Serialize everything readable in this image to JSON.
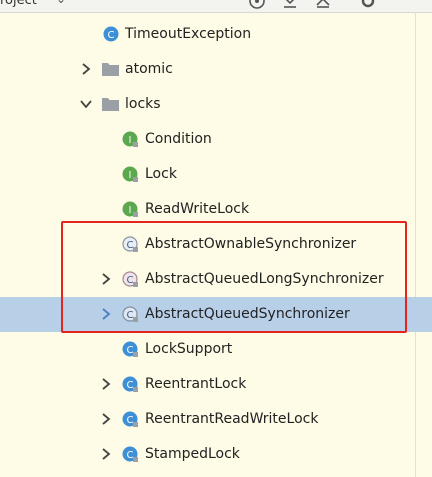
{
  "toolbar": {
    "title": "roject",
    "chevron_icon": "chevron-down-icon",
    "icons": [
      "crosshair-icon",
      "collapse-all-icon",
      "expand-all-icon",
      "gear-icon",
      "minimize-icon"
    ]
  },
  "tree": {
    "items": [
      {
        "label": "TimeoutException",
        "kind": "class",
        "icon_letter": "C"
      },
      {
        "label": "atomic",
        "kind": "folder",
        "expanded": false
      },
      {
        "label": "locks",
        "kind": "folder",
        "expanded": true
      },
      {
        "label": "Condition",
        "kind": "interface",
        "icon_letter": "I"
      },
      {
        "label": "Lock",
        "kind": "interface",
        "icon_letter": "I"
      },
      {
        "label": "ReadWriteLock",
        "kind": "interface",
        "icon_letter": "I"
      },
      {
        "label": "AbstractOwnableSynchronizer",
        "kind": "abstract-class",
        "icon_letter": "C"
      },
      {
        "label": "AbstractQueuedLongSynchronizer",
        "kind": "abstract-class",
        "icon_letter": "C",
        "expandable": true
      },
      {
        "label": "AbstractQueuedSynchronizer",
        "kind": "abstract-class",
        "icon_letter": "C",
        "expandable": true,
        "selected": true
      },
      {
        "label": "LockSupport",
        "kind": "class",
        "icon_letter": "C"
      },
      {
        "label": "ReentrantLock",
        "kind": "class",
        "icon_letter": "C",
        "expandable": true
      },
      {
        "label": "ReentrantReadWriteLock",
        "kind": "class",
        "icon_letter": "C",
        "expandable": true
      },
      {
        "label": "StampedLock",
        "kind": "class",
        "icon_letter": "C",
        "expandable": true
      }
    ]
  },
  "colors": {
    "background": "#fefce6",
    "selection": "#b8cfe8",
    "highlight_border": "#e3241f",
    "class_icon": "#3d8fd6",
    "interface_icon": "#5ba84f",
    "folder_icon": "#9aa0a6"
  }
}
